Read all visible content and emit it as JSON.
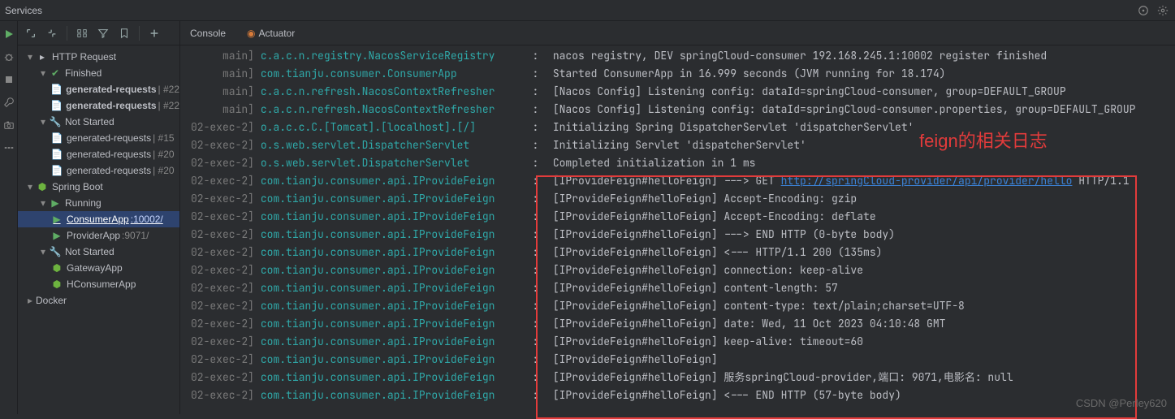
{
  "window": {
    "title": "Services"
  },
  "tree": {
    "http_request": {
      "label": "HTTP Request"
    },
    "finished": {
      "label": "Finished"
    },
    "gen1": {
      "label": "generated-requests",
      "suffix": " | #22"
    },
    "gen2": {
      "label": "generated-requests",
      "suffix": " | #22"
    },
    "not_started1": {
      "label": "Not Started"
    },
    "gen3": {
      "label": "generated-requests",
      "suffix": " | #15"
    },
    "gen4": {
      "label": "generated-requests",
      "suffix": " | #20"
    },
    "gen5": {
      "label": "generated-requests",
      "suffix": " | #20"
    },
    "spring_boot": {
      "label": "Spring Boot"
    },
    "running": {
      "label": "Running"
    },
    "consumer": {
      "label": "ConsumerApp",
      "suffix": " :10002/"
    },
    "provider": {
      "label": "ProviderApp",
      "suffix": " :9071/"
    },
    "not_started2": {
      "label": "Not Started"
    },
    "gateway": {
      "label": "GatewayApp"
    },
    "hconsumer": {
      "label": "HConsumerApp"
    },
    "docker": {
      "label": "Docker"
    }
  },
  "tabs": {
    "console": "Console",
    "actuator": "Actuator"
  },
  "log": [
    {
      "thread": "main]",
      "logger": "c.a.c.n.registry.NacosServiceRegistry",
      "msg": "nacos registry, DEV springCloud-consumer 192.168.245.1:10002 register finished"
    },
    {
      "thread": "main]",
      "logger": "com.tianju.consumer.ConsumerApp",
      "msg": "Started ConsumerApp in 16.999 seconds (JVM running for 18.174)"
    },
    {
      "thread": "main]",
      "logger": "c.a.c.n.refresh.NacosContextRefresher",
      "msg": "[Nacos Config] Listening config: dataId=springCloud-consumer, group=DEFAULT_GROUP"
    },
    {
      "thread": "main]",
      "logger": "c.a.c.n.refresh.NacosContextRefresher",
      "msg": "[Nacos Config] Listening config: dataId=springCloud-consumer.properties, group=DEFAULT_GROUP"
    },
    {
      "thread": "02-exec-2]",
      "logger": "o.a.c.c.C.[Tomcat].[localhost].[/]",
      "msg": "Initializing Spring DispatcherServlet 'dispatcherServlet'"
    },
    {
      "thread": "02-exec-2]",
      "logger": "o.s.web.servlet.DispatcherServlet",
      "msg": "Initializing Servlet 'dispatcherServlet'"
    },
    {
      "thread": "02-exec-2]",
      "logger": "o.s.web.servlet.DispatcherServlet",
      "msg": "Completed initialization in 1 ms"
    },
    {
      "thread": "02-exec-2]",
      "logger": "com.tianju.consumer.api.IProvideFeign",
      "msg_parts": [
        "[IProvideFeign#helloFeign] ---> GET ",
        {
          "link": "http://springCloud-provider/api/provider/hello"
        },
        " HTTP/1.1"
      ]
    },
    {
      "thread": "02-exec-2]",
      "logger": "com.tianju.consumer.api.IProvideFeign",
      "msg": "[IProvideFeign#helloFeign] Accept-Encoding: gzip"
    },
    {
      "thread": "02-exec-2]",
      "logger": "com.tianju.consumer.api.IProvideFeign",
      "msg": "[IProvideFeign#helloFeign] Accept-Encoding: deflate"
    },
    {
      "thread": "02-exec-2]",
      "logger": "com.tianju.consumer.api.IProvideFeign",
      "msg": "[IProvideFeign#helloFeign] ---> END HTTP (0-byte body)"
    },
    {
      "thread": "02-exec-2]",
      "logger": "com.tianju.consumer.api.IProvideFeign",
      "msg": "[IProvideFeign#helloFeign] <--- HTTP/1.1 200 (135ms)"
    },
    {
      "thread": "02-exec-2]",
      "logger": "com.tianju.consumer.api.IProvideFeign",
      "msg": "[IProvideFeign#helloFeign] connection: keep-alive"
    },
    {
      "thread": "02-exec-2]",
      "logger": "com.tianju.consumer.api.IProvideFeign",
      "msg": "[IProvideFeign#helloFeign] content-length: 57"
    },
    {
      "thread": "02-exec-2]",
      "logger": "com.tianju.consumer.api.IProvideFeign",
      "msg": "[IProvideFeign#helloFeign] content-type: text/plain;charset=UTF-8"
    },
    {
      "thread": "02-exec-2]",
      "logger": "com.tianju.consumer.api.IProvideFeign",
      "msg": "[IProvideFeign#helloFeign] date: Wed, 11 Oct 2023 04:10:48 GMT"
    },
    {
      "thread": "02-exec-2]",
      "logger": "com.tianju.consumer.api.IProvideFeign",
      "msg": "[IProvideFeign#helloFeign] keep-alive: timeout=60"
    },
    {
      "thread": "02-exec-2]",
      "logger": "com.tianju.consumer.api.IProvideFeign",
      "msg": "[IProvideFeign#helloFeign] "
    },
    {
      "thread": "02-exec-2]",
      "logger": "com.tianju.consumer.api.IProvideFeign",
      "msg": "[IProvideFeign#helloFeign] 服务springCloud-provider,端口: 9071,电影名: null"
    },
    {
      "thread": "02-exec-2]",
      "logger": "com.tianju.consumer.api.IProvideFeign",
      "msg": "[IProvideFeign#helloFeign] <--- END HTTP (57-byte body)"
    }
  ],
  "annotation": "feign的相关日志",
  "watermark": "CSDN @Perley620"
}
